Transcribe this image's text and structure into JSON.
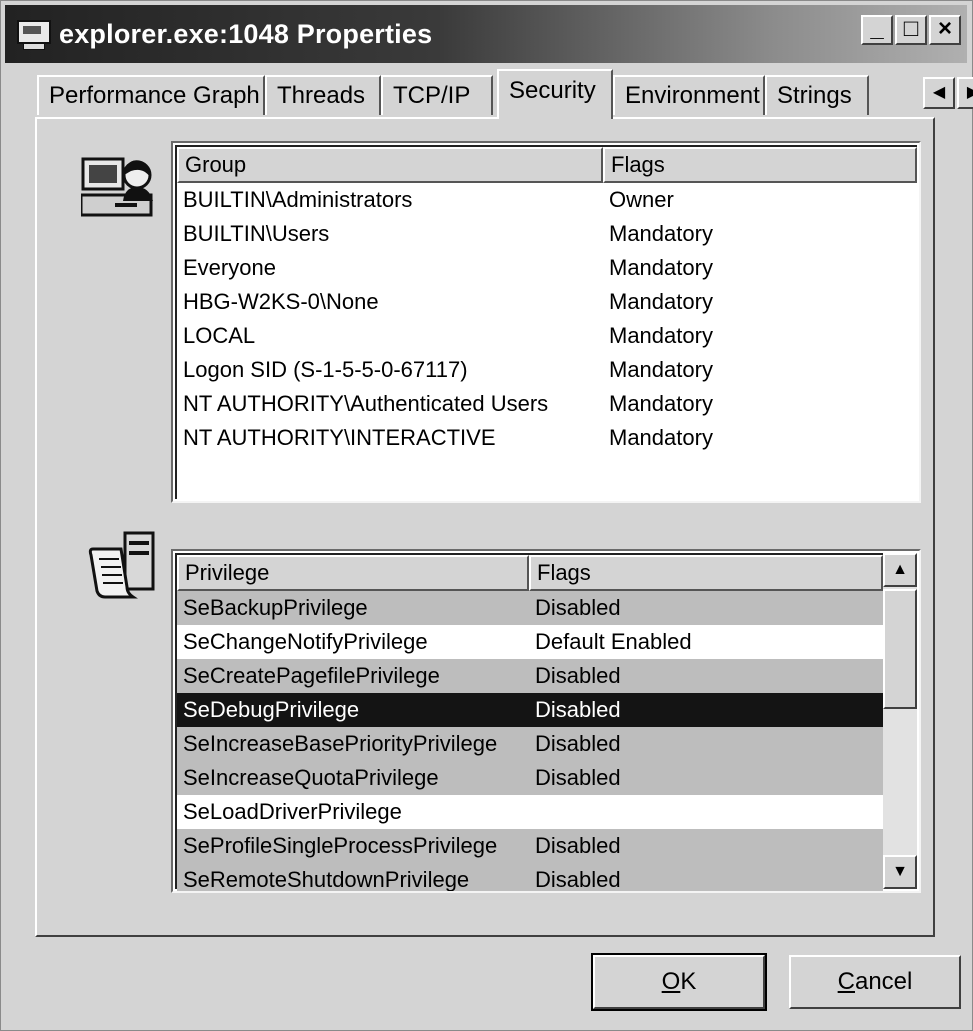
{
  "window": {
    "title": "explorer.exe:1048 Properties",
    "controls": {
      "minimize": "_",
      "maximize": "□",
      "close": "×"
    }
  },
  "tabs": [
    {
      "label": "Performance Graph",
      "active": false
    },
    {
      "label": "Threads",
      "active": false
    },
    {
      "label": "TCP/IP",
      "active": false
    },
    {
      "label": "Security",
      "active": true
    },
    {
      "label": "Environment",
      "active": false
    },
    {
      "label": "Strings",
      "active": false
    }
  ],
  "tab_scroll": {
    "left": "◀",
    "right": "▶"
  },
  "groups_list": {
    "icon": "user-computer-icon",
    "headers": {
      "group": "Group",
      "flags": "Flags"
    },
    "rows": [
      {
        "group": "BUILTIN\\Administrators",
        "flags": "Owner"
      },
      {
        "group": "BUILTIN\\Users",
        "flags": "Mandatory"
      },
      {
        "group": "Everyone",
        "flags": "Mandatory"
      },
      {
        "group": "HBG-W2KS-0\\None",
        "flags": "Mandatory"
      },
      {
        "group": "LOCAL",
        "flags": "Mandatory"
      },
      {
        "group": "Logon SID (S-1-5-5-0-67117)",
        "flags": "Mandatory"
      },
      {
        "group": "NT AUTHORITY\\Authenticated Users",
        "flags": "Mandatory"
      },
      {
        "group": "NT AUTHORITY\\INTERACTIVE",
        "flags": "Mandatory"
      }
    ]
  },
  "privileges_list": {
    "icon": "privilege-scroll-icon",
    "headers": {
      "privilege": "Privilege",
      "flags": "Flags"
    },
    "rows": [
      {
        "privilege": "SeBackupPrivilege",
        "flags": "Disabled",
        "style": "grey"
      },
      {
        "privilege": "SeChangeNotifyPrivilege",
        "flags": "Default Enabled",
        "style": "white"
      },
      {
        "privilege": "SeCreatePagefilePrivilege",
        "flags": "Disabled",
        "style": "grey"
      },
      {
        "privilege": "SeDebugPrivilege",
        "flags": "Disabled",
        "style": "sel"
      },
      {
        "privilege": "SeIncreaseBasePriorityPrivilege",
        "flags": "Disabled",
        "style": "grey"
      },
      {
        "privilege": "SeIncreaseQuotaPrivilege",
        "flags": "Disabled",
        "style": "grey"
      },
      {
        "privilege": "SeLoadDriverPrivilege",
        "flags": "",
        "style": "white"
      },
      {
        "privilege": "SeProfileSingleProcessPrivilege",
        "flags": "Disabled",
        "style": "grey"
      },
      {
        "privilege": "SeRemoteShutdownPrivilege",
        "flags": "Disabled",
        "style": "grey"
      }
    ],
    "scroll": {
      "up": "▲",
      "down": "▼"
    }
  },
  "buttons": {
    "ok": {
      "accel": "O",
      "rest": "K"
    },
    "cancel": {
      "accel": "C",
      "rest": "ancel"
    }
  }
}
